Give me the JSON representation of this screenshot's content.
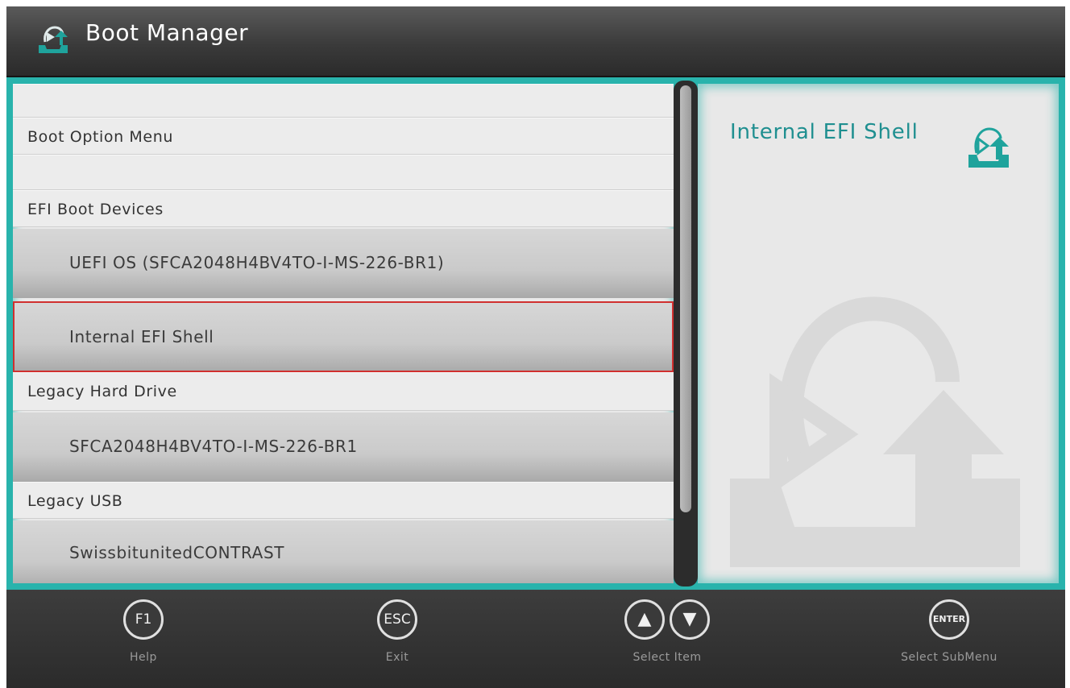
{
  "header": {
    "title": "Boot Manager",
    "logo_icon": "boot-manager-logo-icon"
  },
  "menu": {
    "rows": [
      {
        "kind": "blank",
        "label": ""
      },
      {
        "kind": "section",
        "label": "Boot Option Menu"
      },
      {
        "kind": "blank",
        "label": ""
      },
      {
        "kind": "section",
        "label": "EFI Boot Devices"
      },
      {
        "kind": "option",
        "label": "UEFI OS (SFCA2048H4BV4TO-I-MS-226-BR1)"
      },
      {
        "kind": "option",
        "label": "Internal EFI Shell",
        "selected": true
      },
      {
        "kind": "section",
        "label": "Legacy Hard Drive"
      },
      {
        "kind": "option",
        "label": "SFCA2048H4BV4TO-I-MS-226-BR1"
      },
      {
        "kind": "section",
        "label": "Legacy USB"
      },
      {
        "kind": "option",
        "label": "SwissbitunitedCONTRAST"
      }
    ]
  },
  "help_panel": {
    "title": "Internal EFI Shell",
    "icon": "boot-reload-icon"
  },
  "footer": {
    "keys": [
      {
        "key": "F1",
        "label": "Help"
      },
      {
        "key": "ESC",
        "label": "Exit"
      },
      {
        "key": "↑↓",
        "label": "Select Item"
      },
      {
        "key": "ENTER",
        "label": "Select  SubMenu"
      }
    ]
  },
  "colors": {
    "accent_teal": "#29b3ac",
    "help_title": "#1f8f90",
    "selection_border": "#d0302f",
    "header_bg": "#3a3a3a"
  }
}
